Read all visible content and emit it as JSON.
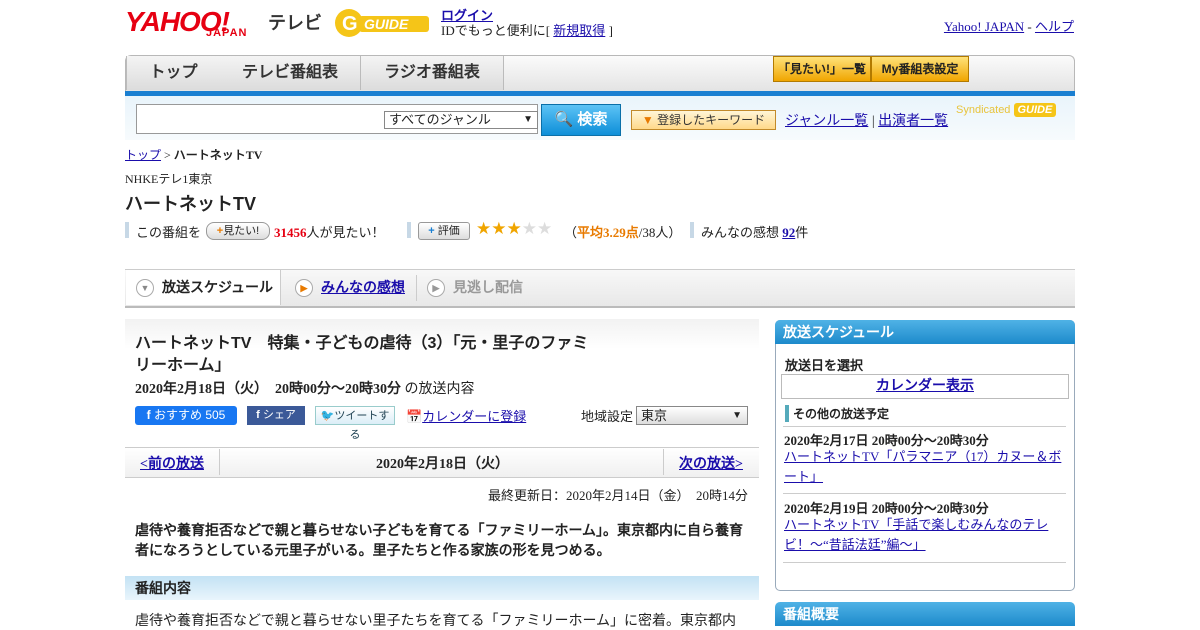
{
  "header": {
    "yahoo_logo": "YAHOO!",
    "japan_logo": "JAPAN",
    "tv_label": "テレビ",
    "gguide_logo": "GUIDE",
    "login": "ログイン",
    "id_prefix": "IDでもっと便利に[ ",
    "signup": "新規取得",
    "id_suffix": " ]",
    "yahoo_japan_link": "Yahoo! JAPAN",
    "sep": " - ",
    "help_link": "ヘルプ"
  },
  "nav": {
    "tabs": [
      "トップ",
      "テレビ番組表",
      "ラジオ番組表"
    ],
    "mitai_list": "「見たい!」一覧",
    "my_schedule": "My番組表設定"
  },
  "search": {
    "genre_selected": "すべてのジャンル",
    "button": "検索",
    "keyword_button": "登録したキーワード",
    "genre_list": "ジャンル一覧",
    "divider": "|",
    "performer_list": "出演者一覧",
    "syndicated": "Syndicated",
    "syndicated_logo": "GUIDE"
  },
  "breadcrumb": {
    "top": "トップ",
    "sep": " > ",
    "current": "ハートネットTV"
  },
  "program": {
    "channel": "NHKEテレ1東京",
    "title": "ハートネットTV",
    "mitai_prefix": "この番組を",
    "mitai_button": "見たい!",
    "mitai_count": "31456",
    "mitai_suffix": "人が見たい！",
    "rating_button": "評価",
    "rating_stars": 3,
    "rating_max": 5,
    "rating_open": "（",
    "rating_avg": "平均3.29点",
    "rating_people": "/38人）",
    "reviews_prefix": "みんなの感想 ",
    "reviews_count": "92",
    "reviews_suffix": "件"
  },
  "content_tabs": {
    "schedule": "放送スケジュール",
    "reviews": "みんなの感想",
    "vod": "見逃し配信"
  },
  "episode": {
    "title": "ハートネットTV　特集・子どもの虐待（3）「元・里子のファミリーホーム」",
    "datetime": "2020年2月18日（火）　20時00分～20時30分",
    "datetime_suffix": "  の放送内容",
    "fb_recommend": "おすすめ",
    "fb_count": "505",
    "fb_share": "シェア",
    "tweet": "ツイートする",
    "calendar_register": "カレンダーに登録",
    "region_label": "地域設定",
    "region_value": "東京"
  },
  "pager": {
    "prev": "<前の放送",
    "date": "2020年2月18日（火）",
    "next": "次の放送>"
  },
  "updated": "最終更新日：2020年2月14日（金）　20時14分",
  "summary": "虐待や養育拒否などで親と暮らせない子どもを育てる「ファミリーホーム」。東京都内に自ら養育者になろうとしている元里子がいる。里子たちと作る家族の形を見つめる。",
  "section_title": "番組内容",
  "detail": "虐待や養育拒否などで親と暮らせない里子たちを育てる「ファミリーホーム」に密着。東京都内",
  "sidebar": {
    "head": "放送スケジュール",
    "select_date": "放送日を選択",
    "calendar": "カレンダー表示",
    "other": "その他の放送予定",
    "items": [
      {
        "date": "2020年2月17日  20時00分～20時30分",
        "title": "ハートネットTV「パラマニア（17）カヌー＆ボート」"
      },
      {
        "date": "2020年2月19日  20時00分～20時30分",
        "title": "ハートネットTV「手話で楽しむみんなのテレビ！～“昔話法廷”編～」"
      }
    ],
    "overview_head": "番組概要"
  },
  "colors": {
    "accent_blue": "#1a7fd1",
    "yahoo_red": "#e60012",
    "rating_orange": "#e87a00",
    "link": "#1a0dab"
  }
}
